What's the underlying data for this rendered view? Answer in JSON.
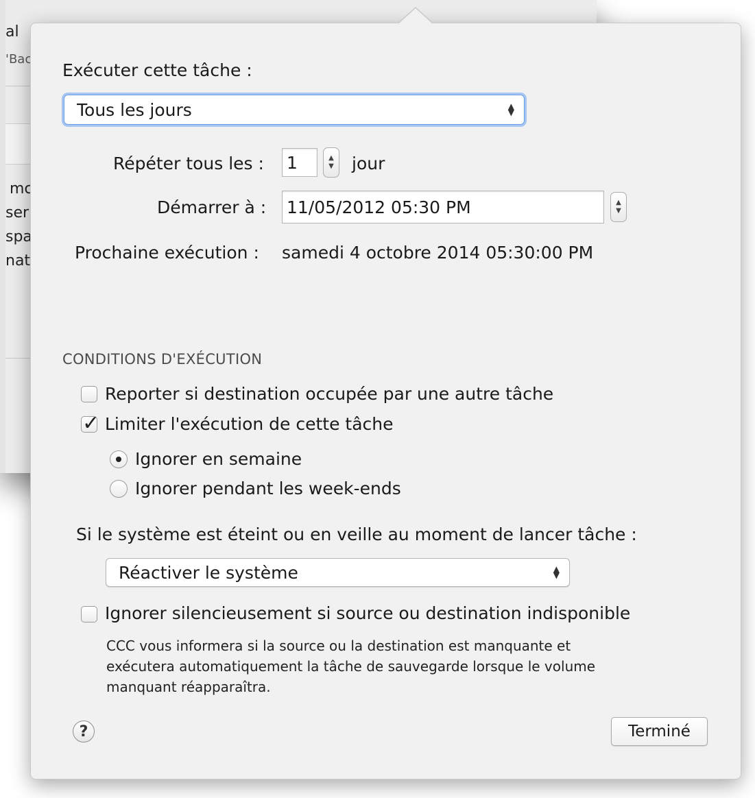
{
  "background": {
    "fragments": [
      "al",
      "'Bac",
      "mc",
      "ser",
      "spa",
      "nat"
    ]
  },
  "popover": {
    "run_task_label": "Exécuter cette tâche :",
    "frequency_select": {
      "value": "Tous les jours"
    },
    "repeat": {
      "label": "Répéter tous les :",
      "value": "1",
      "unit": "jour"
    },
    "start": {
      "label": "Démarrer à :",
      "value": "11/05/2012 05:30 PM"
    },
    "next_run": {
      "label": "Prochaine exécution :",
      "value": "samedi 4 octobre 2014 05:30:00 PM"
    },
    "conditions_title": "CONDITIONS D'EXÉCUTION",
    "defer_checkbox": {
      "label": "Reporter si destination occupée par une autre tâche",
      "checked": false
    },
    "limit_checkbox": {
      "label": "Limiter l'exécution de cette tâche",
      "checked": true
    },
    "radio_weekdays": {
      "label": "Ignorer en semaine",
      "selected": true
    },
    "radio_weekends": {
      "label": "Ignorer pendant les week-ends",
      "selected": false
    },
    "system_off_label": "Si le système est éteint ou en veille au moment de lancer tâche :",
    "system_select": {
      "value": "Réactiver le système"
    },
    "ignore_checkbox": {
      "label": "Ignorer silencieusement si source ou destination indisponible",
      "checked": false
    },
    "note_lines": [
      "CCC vous informera si la source ou la destination est manquante et",
      "exécutera automatiquement la tâche de sauvegarde lorsque le volume",
      "manquant réapparaîtra."
    ],
    "help_glyph": "?",
    "done_button": "Terminé"
  },
  "icons": {
    "help": "help-icon",
    "updown": "updown-arrows-icon",
    "checkmark": "checkmark-icon"
  }
}
